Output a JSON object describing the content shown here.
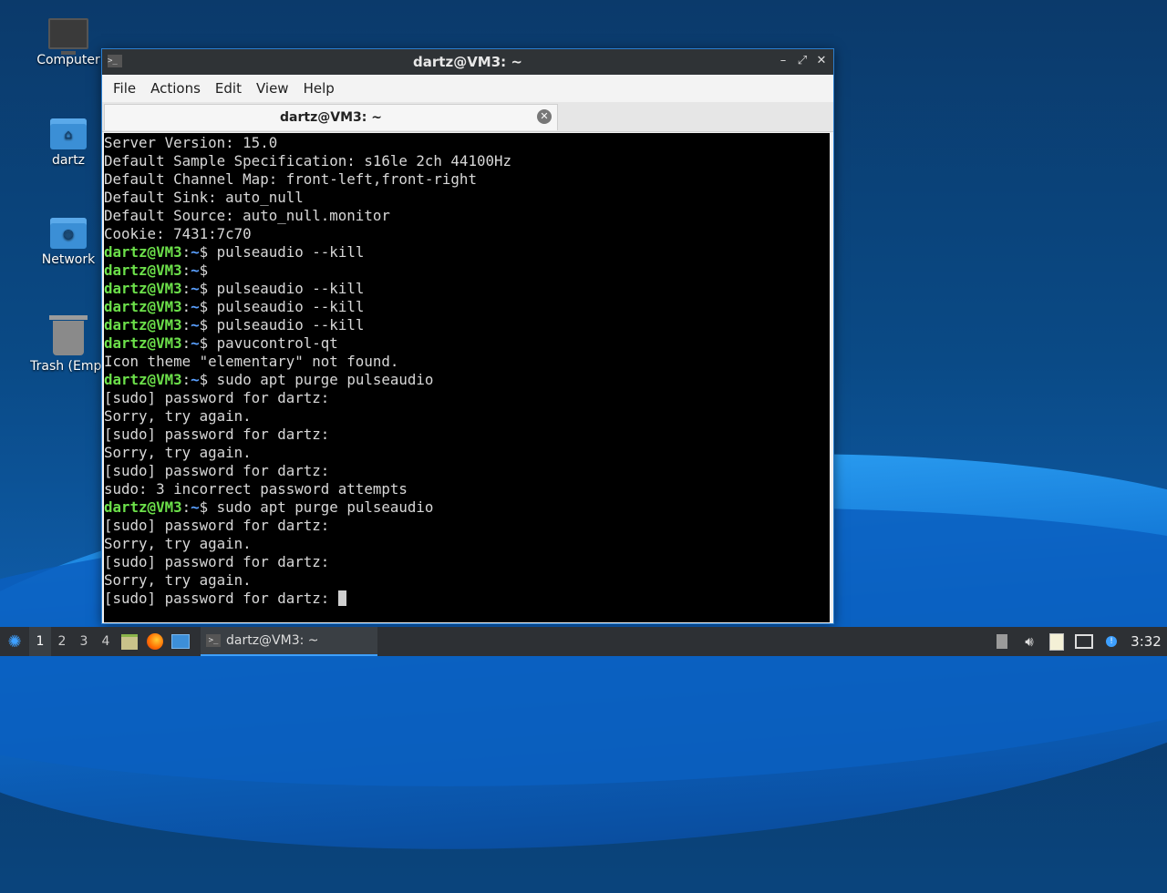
{
  "desktop": {
    "icons": [
      {
        "label": "Computer",
        "icon": "computer-icon"
      },
      {
        "label": "dartz",
        "icon": "home-folder-icon"
      },
      {
        "label": "Network",
        "icon": "network-folder-icon"
      },
      {
        "label": "Trash (Empt",
        "icon": "trash-icon"
      }
    ]
  },
  "window": {
    "title": "dartz@VM3: ~",
    "buttons": {
      "minimize": "–",
      "maximize": "⤢",
      "close": "✕"
    },
    "menu": [
      "File",
      "Actions",
      "Edit",
      "View",
      "Help"
    ],
    "tab": {
      "label": "dartz@VM3: ~",
      "close": "✕"
    }
  },
  "terminal": {
    "prompt_user": "dartz@VM3",
    "prompt_sep": ":",
    "prompt_path": "~",
    "prompt_symbol": "$",
    "lines": [
      {
        "type": "out",
        "text": "Server Version: 15.0"
      },
      {
        "type": "out",
        "text": "Default Sample Specification: s16le 2ch 44100Hz"
      },
      {
        "type": "out",
        "text": "Default Channel Map: front-left,front-right"
      },
      {
        "type": "out",
        "text": "Default Sink: auto_null"
      },
      {
        "type": "out",
        "text": "Default Source: auto_null.monitor"
      },
      {
        "type": "out",
        "text": "Cookie: 7431:7c70"
      },
      {
        "type": "cmd",
        "text": " pulseaudio --kill"
      },
      {
        "type": "cmd",
        "text": ""
      },
      {
        "type": "cmd",
        "text": " pulseaudio --kill"
      },
      {
        "type": "cmd",
        "text": " pulseaudio --kill"
      },
      {
        "type": "cmd",
        "text": " pulseaudio --kill"
      },
      {
        "type": "cmd",
        "text": " pavucontrol-qt"
      },
      {
        "type": "out",
        "text": "Icon theme \"elementary\" not found."
      },
      {
        "type": "cmd",
        "text": " sudo apt purge pulseaudio"
      },
      {
        "type": "out",
        "text": "[sudo] password for dartz:"
      },
      {
        "type": "out",
        "text": "Sorry, try again."
      },
      {
        "type": "out",
        "text": "[sudo] password for dartz:"
      },
      {
        "type": "out",
        "text": "Sorry, try again."
      },
      {
        "type": "out",
        "text": "[sudo] password for dartz:"
      },
      {
        "type": "out",
        "text": "sudo: 3 incorrect password attempts"
      },
      {
        "type": "cmd",
        "text": " sudo apt purge pulseaudio"
      },
      {
        "type": "out",
        "text": "[sudo] password for dartz:"
      },
      {
        "type": "out",
        "text": "Sorry, try again."
      },
      {
        "type": "out",
        "text": "[sudo] password for dartz:"
      },
      {
        "type": "out",
        "text": "Sorry, try again."
      },
      {
        "type": "out",
        "text": "[sudo] password for dartz: ",
        "cursor": true
      }
    ]
  },
  "taskbar": {
    "start_icon": "lubuntu-start-icon",
    "workspaces": [
      "1",
      "2",
      "3",
      "4"
    ],
    "active_workspace": "1",
    "launchers": [
      "file-manager-icon",
      "firefox-icon",
      "show-desktop-icon"
    ],
    "task_label": "dartz@VM3: ~",
    "tray": [
      "removable-drive-icon",
      "volume-icon",
      "clipboard-icon",
      "network-icon",
      "update-notifier-icon"
    ],
    "clock": "3:32"
  },
  "colors": {
    "prompt_user": "#6ce04a",
    "prompt_path": "#5aa0ff",
    "window_accent": "#2b7fd0"
  }
}
